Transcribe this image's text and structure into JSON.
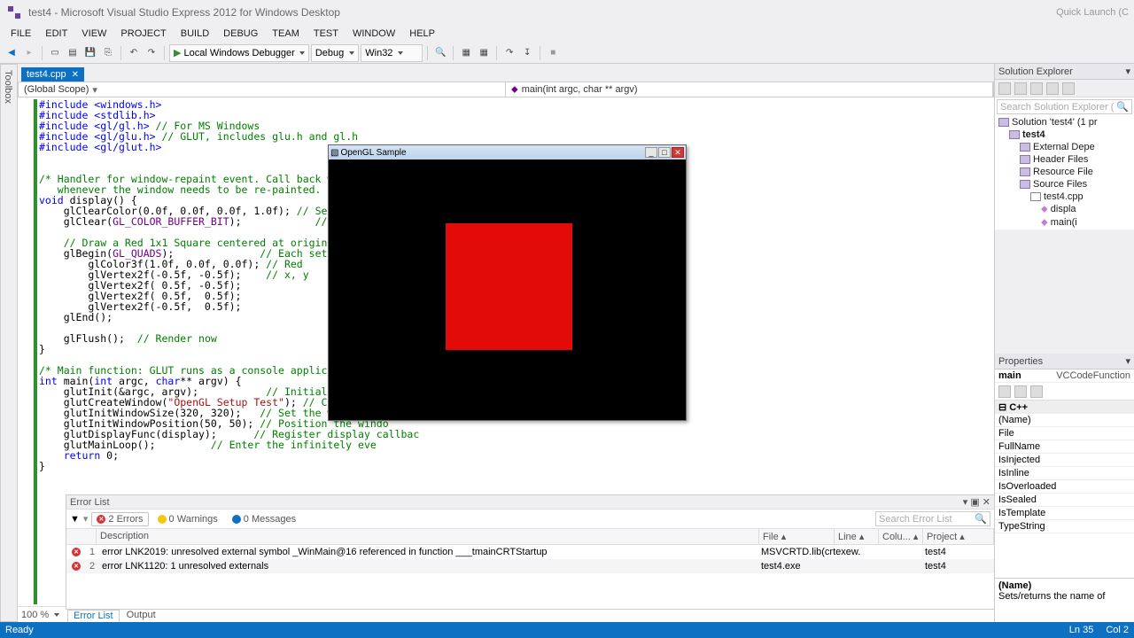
{
  "title": "test4 - Microsoft Visual Studio Express 2012 for Windows Desktop",
  "quick_launch": "Quick Launch (C",
  "menu": [
    "FILE",
    "EDIT",
    "VIEW",
    "PROJECT",
    "BUILD",
    "DEBUG",
    "TEAM",
    "TEST",
    "WINDOW",
    "HELP"
  ],
  "toolbar": {
    "debug_btn": "Local Windows Debugger",
    "config": "Debug",
    "platform": "Win32"
  },
  "sidebar_tab": "Toolbox",
  "doctab": {
    "name": "test4.cpp"
  },
  "scope": {
    "left": "(Global Scope)",
    "right": "main(int argc, char ** argv)"
  },
  "zoom": "100 %",
  "opengl_window_title": "OpenGL Sample",
  "code_lines": [
    {
      "t": "inc",
      "s": "#include <windows.h>"
    },
    {
      "t": "inc",
      "s": "#include <stdlib.h>"
    },
    {
      "t": "mix",
      "s": "#include <gl/gl.h>",
      "c": " // For MS Windows"
    },
    {
      "t": "mix",
      "s": "#include <gl/glu.h>",
      "c": " // GLUT, includes glu.h and gl.h"
    },
    {
      "t": "inc",
      "s": "#include <gl/glut.h>"
    },
    {
      "t": "blank",
      "s": ""
    },
    {
      "t": "blank",
      "s": ""
    },
    {
      "t": "cmt",
      "s": "/* Handler for window-repaint event. Call back when the"
    },
    {
      "t": "cmt",
      "s": "   whenever the window needs to be re-painted. */"
    },
    {
      "t": "code",
      "s": "void display() {"
    },
    {
      "t": "mixc",
      "s": "    glClearColor(0.0f, 0.0f, 0.0f, 1.0f);",
      "c": " // Set backgro"
    },
    {
      "t": "mixm",
      "s": "    glClear(",
      "m": "GL_COLOR_BUFFER_BIT",
      "s2": ");            ",
      "c": "// Clear the co"
    },
    {
      "t": "blank",
      "s": ""
    },
    {
      "t": "cmt",
      "s": "    // Draw a Red 1x1 Square centered at origin"
    },
    {
      "t": "mixm",
      "s": "    glBegin(",
      "m": "GL_QUADS",
      "s2": ");              ",
      "c": "// Each set of 4 vert"
    },
    {
      "t": "mixc",
      "s": "        glColor3f(1.0f, 0.0f, 0.0f);",
      "c": " // Red"
    },
    {
      "t": "mixc",
      "s": "        glVertex2f(-0.5f, -0.5f);   ",
      "c": " // x, y"
    },
    {
      "t": "code",
      "s": "        glVertex2f( 0.5f, -0.5f);"
    },
    {
      "t": "code",
      "s": "        glVertex2f( 0.5f,  0.5f);"
    },
    {
      "t": "code",
      "s": "        glVertex2f(-0.5f,  0.5f);"
    },
    {
      "t": "code",
      "s": "    glEnd();"
    },
    {
      "t": "blank",
      "s": ""
    },
    {
      "t": "mixc",
      "s": "    glFlush(); ",
      "c": " // Render now"
    },
    {
      "t": "code",
      "s": "}"
    },
    {
      "t": "blank",
      "s": ""
    },
    {
      "t": "cmt",
      "s": "/* Main function: GLUT runs as a console application sta"
    },
    {
      "t": "code",
      "s": "int main(int argc, char** argv) {"
    },
    {
      "t": "mixc",
      "s": "    glutInit(&argc, argv);           ",
      "c": "// Initialize "
    },
    {
      "t": "mixs",
      "s": "    glutCreateWindow(",
      "str": "\"OpenGL Setup Test\"",
      "s2": ");",
      "c": " // Create a w"
    },
    {
      "t": "mixc",
      "s": "    glutInitWindowSize(320, 320);  ",
      "c": " // Set the window's i"
    },
    {
      "t": "mixc",
      "s": "    glutInitWindowPosition(50, 50);",
      "c": " // Position the windo"
    },
    {
      "t": "mixc",
      "s": "    glutDisplayFunc(display);      ",
      "c": "// Register display callbac"
    },
    {
      "t": "mixc",
      "s": "    glutMainLoop();        ",
      "c": " // Enter the infinitely eve"
    },
    {
      "t": "code",
      "s": "    return 0;"
    },
    {
      "t": "code",
      "s": "}"
    }
  ],
  "solution_explorer": {
    "title": "Solution Explorer",
    "search": "Search Solution Explorer (",
    "root": "Solution 'test4' (1 pr",
    "project": "test4",
    "folders": {
      "ext": "External Depe",
      "hdr": "Header Files",
      "res": "Resource File",
      "src": "Source Files"
    },
    "file": "test4.cpp",
    "funcs": {
      "d": "displa",
      "m": "main(i"
    }
  },
  "properties": {
    "title": "Properties",
    "context": {
      "name": "main",
      "type": "VCCodeFunction"
    },
    "group": "C++",
    "items": [
      "(Name)",
      "File",
      "FullName",
      "IsInjected",
      "IsInline",
      "IsOverloaded",
      "IsSealed",
      "IsTemplate",
      "TypeString"
    ],
    "desc": {
      "label": "(Name)",
      "text": "Sets/returns the name of"
    }
  },
  "error_list": {
    "title": "Error List",
    "pills": {
      "errors": "2 Errors",
      "warnings": "0 Warnings",
      "messages": "0 Messages"
    },
    "search": "Search Error List",
    "cols": {
      "desc": "Description",
      "file": "File",
      "line": "Line",
      "col": "Colu...",
      "proj": "Project"
    },
    "rows": [
      {
        "n": "1",
        "desc": "error LNK2019: unresolved external symbol _WinMain@16 referenced in function ___tmainCRTStartup",
        "file": "MSVCRTD.lib(crtexew.",
        "proj": "test4"
      },
      {
        "n": "2",
        "desc": "error LNK1120: 1 unresolved externals",
        "file": "test4.exe",
        "proj": "test4"
      }
    ],
    "tabs": {
      "errorlist": "Error List",
      "output": "Output"
    }
  },
  "status": {
    "left": "Ready",
    "ln": "Ln 35",
    "col": "Col 2"
  }
}
